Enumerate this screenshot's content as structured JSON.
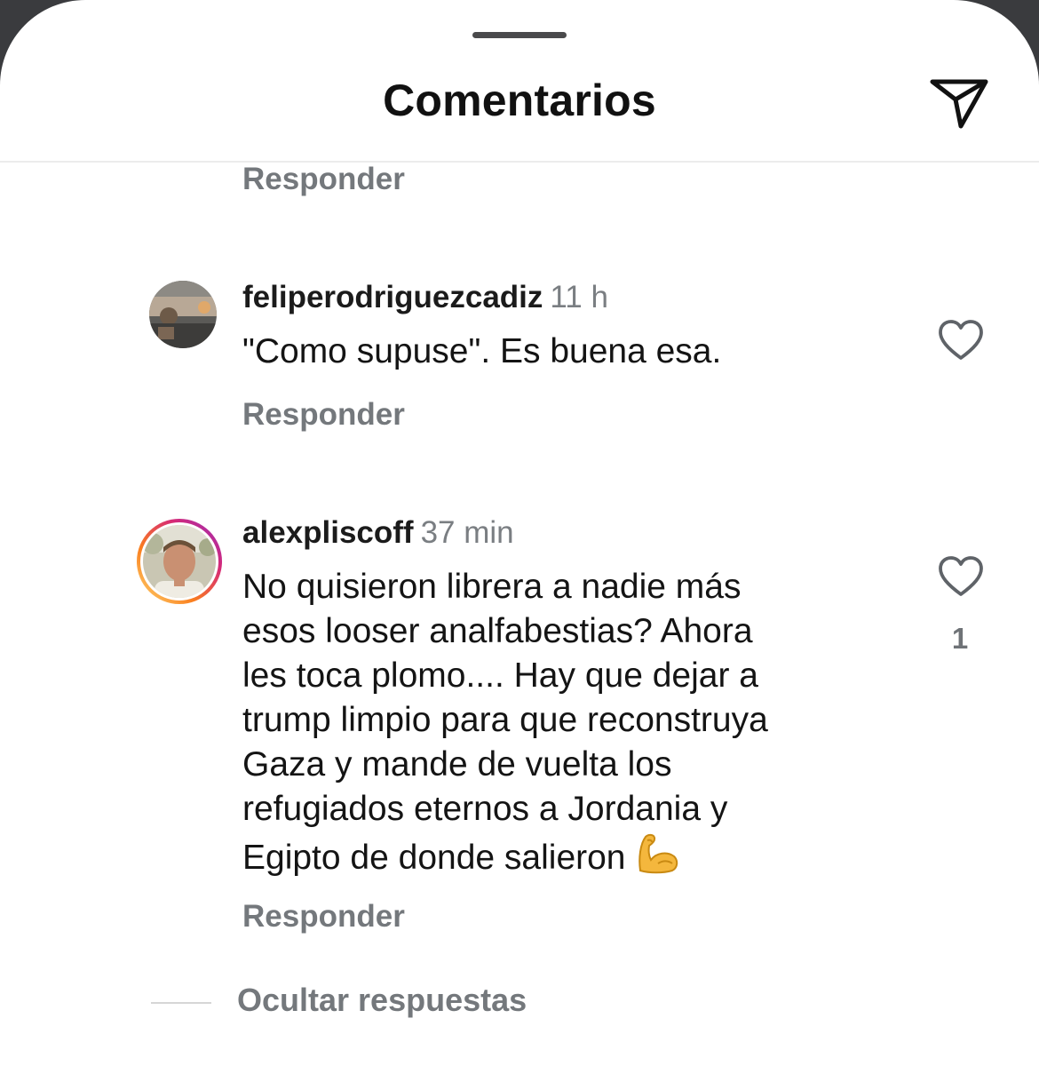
{
  "header": {
    "title": "Comentarios",
    "send_icon": "paper-plane-icon"
  },
  "comments": [
    {
      "reply_label": "Responder"
    },
    {
      "username": "feliperodriguezcadiz",
      "time": "11 h",
      "text": "\"Como supuse\". Es buena esa.",
      "reply_label": "Responder",
      "like_icon": "heart-outline-icon"
    },
    {
      "username": "alexpliscoff",
      "time": "37 min",
      "text": "No quisieron librera a nadie más\nesos looser analfabestias? Ahora\nles toca plomo.... Hay que dejar a\ntrump limpio para que reconstruya\nGaza y mande de vuelta los\nrefugiados eternos a Jordania y\nEgipto de donde salieron",
      "emoji": "flexed-biceps-emoji",
      "reply_label": "Responder",
      "like_icon": "heart-outline-icon",
      "like_count": "1",
      "story_ring_colors": [
        "#feda75",
        "#fa7e1e",
        "#d62976",
        "#962fbf"
      ]
    }
  ],
  "hide_replies_label": "Ocultar respuestas",
  "colors": {
    "primary_text": "#141414",
    "secondary_text": "#74787c",
    "background": "#ffffff"
  }
}
